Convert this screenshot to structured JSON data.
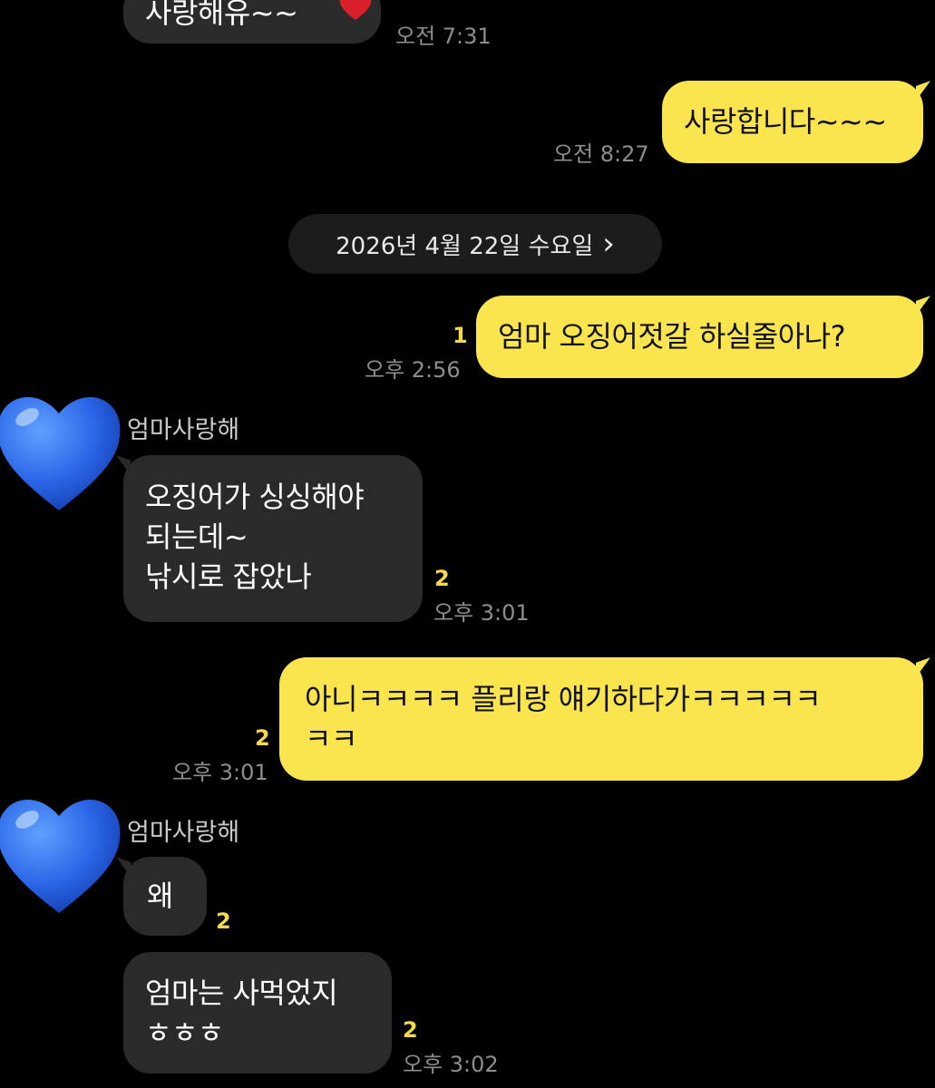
{
  "messages": {
    "m0": {
      "text": "사랑해유~~",
      "time": "오전 7:31"
    },
    "m1": {
      "text": "사랑합니다~~~",
      "time": "오전 8:27"
    },
    "date_divider": {
      "label": "2026년 4월 22일 수요일",
      "chevron": "›"
    },
    "m2": {
      "text": "엄마 오징어젓갈 하실줄아나?",
      "time": "오후 2:56",
      "unread": "1"
    },
    "m3": {
      "sender": "엄마사랑해",
      "lines": [
        "오징어가 싱싱해야",
        "되는데~",
        "낚시로 잡았나"
      ],
      "time": "오후 3:01",
      "unread": "2"
    },
    "m4": {
      "lines": [
        "아니ㅋㅋㅋㅋ 플리랑 얘기하다가ㅋㅋㅋㅋㅋ",
        "ㅋㅋ"
      ],
      "time": "오후 3:01",
      "unread": "2"
    },
    "m5": {
      "sender": "엄마사랑해",
      "text": "왜",
      "unread": "2"
    },
    "m6": {
      "lines": [
        "엄마는 사먹었지",
        "ㅎㅎㅎ"
      ],
      "time": "오후 3:02",
      "unread": "2"
    }
  },
  "icons": {
    "avatar": "blue-heart-icon",
    "partial_emoji": "red-heart-icon",
    "chevron": "chevron-right-icon"
  },
  "colors": {
    "background": "#000000",
    "outgoing": "#fbe54e",
    "incoming": "#2a2a2a",
    "unread": "#f6d84c",
    "avatar": "#2f6ff0"
  }
}
